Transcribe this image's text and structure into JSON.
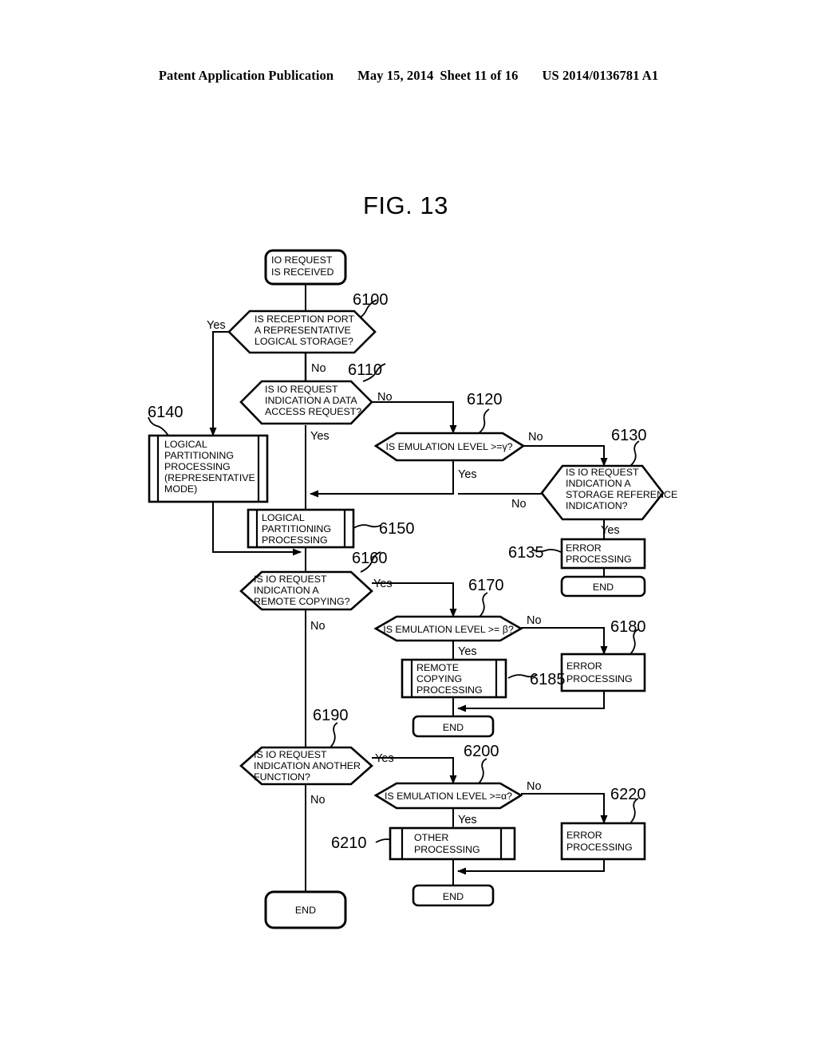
{
  "header": {
    "publication": "Patent Application Publication",
    "date": "May 15, 2014",
    "sheet": "Sheet 11 of 16",
    "patent_number": "US 2014/0136781 A1"
  },
  "figure": {
    "title": "FIG. 13"
  },
  "nodes": {
    "start": {
      "id": "start",
      "label_lines": [
        "IO REQUEST",
        "IS RECEIVED"
      ],
      "shape": "terminator"
    },
    "n6100": {
      "ref": "6100",
      "label_lines": [
        "IS RECEPTION PORT",
        "A REPRESENTATIVE",
        "LOGICAL STORAGE?"
      ],
      "shape": "decision"
    },
    "n6110": {
      "ref": "6110",
      "label_lines": [
        "IS IO REQUEST",
        "INDICATION A DATA",
        "ACCESS REQUEST?"
      ],
      "shape": "decision"
    },
    "n6120": {
      "ref": "6120",
      "label_lines": [
        "IS EMULATION LEVEL >=γ?"
      ],
      "shape": "decision"
    },
    "n6130": {
      "ref": "6130",
      "label_lines": [
        "IS IO REQUEST",
        "INDICATION A",
        "STORAGE REFERENCE",
        "INDICATION?"
      ],
      "shape": "decision"
    },
    "n6135": {
      "ref": "6135",
      "label_lines": [
        "ERROR",
        "PROCESSING"
      ],
      "shape": "process"
    },
    "n6140": {
      "ref": "6140",
      "label_lines": [
        "LOGICAL",
        "PARTITIONING",
        "PROCESSING",
        "(REPRESENTATIVE",
        "MODE)"
      ],
      "shape": "predefined"
    },
    "n6150": {
      "ref": "6150",
      "label_lines": [
        "LOGICAL",
        "PARTITIONING",
        "PROCESSING"
      ],
      "shape": "predefined"
    },
    "n6160": {
      "ref": "6160",
      "label_lines": [
        "IS IO REQUEST",
        "INDICATION A",
        "REMOTE COPYING?"
      ],
      "shape": "decision"
    },
    "n6170": {
      "ref": "6170",
      "label_lines": [
        "IS EMULATION LEVEL >= β?"
      ],
      "shape": "decision"
    },
    "n6180": {
      "ref": "6180",
      "label_lines": [
        "ERROR",
        "PROCESSING"
      ],
      "shape": "process"
    },
    "n6185": {
      "ref": "6185",
      "label_lines": [
        "REMOTE",
        "COPYING",
        "PROCESSING"
      ],
      "shape": "predefined"
    },
    "n6190": {
      "ref": "6190",
      "label_lines": [
        "IS IO REQUEST",
        "INDICATION ANOTHER",
        "FUNCTION?"
      ],
      "shape": "decision"
    },
    "n6200": {
      "ref": "6200",
      "label_lines": [
        "IS EMULATION LEVEL >=α?"
      ],
      "shape": "decision"
    },
    "n6210": {
      "ref": "6210",
      "label_lines": [
        "OTHER",
        "PROCESSING"
      ],
      "shape": "predefined"
    },
    "n6220": {
      "ref": "6220",
      "label_lines": [
        "ERROR",
        "PROCESSING"
      ],
      "shape": "process"
    },
    "end_6135": {
      "label_lines": [
        "END"
      ],
      "shape": "terminator"
    },
    "end_6185": {
      "label_lines": [
        "END"
      ],
      "shape": "terminator"
    },
    "end_6210": {
      "label_lines": [
        "END"
      ],
      "shape": "terminator"
    },
    "end_main": {
      "label_lines": [
        "END"
      ],
      "shape": "terminator"
    }
  },
  "edge_labels": {
    "e6100_yes": "Yes",
    "e6100_no": "No",
    "e6110_no": "No",
    "e6110_yes": "Yes",
    "e6120_no": "No",
    "e6120_yes": "Yes",
    "e6130_no": "No",
    "e6130_yes": "Yes",
    "e6160_yes": "Yes",
    "e6160_no": "No",
    "e6170_no": "No",
    "e6170_yes": "Yes",
    "e6190_yes": "Yes",
    "e6190_no": "No",
    "e6200_no": "No",
    "e6200_yes": "Yes"
  },
  "refs": {
    "r6100": "6100",
    "r6110": "6110",
    "r6120": "6120",
    "r6130": "6130",
    "r6135": "6135",
    "r6140": "6140",
    "r6150": "6150",
    "r6160": "6160",
    "r6170": "6170",
    "r6180": "6180",
    "r6185": "6185",
    "r6190": "6190",
    "r6200": "6200",
    "r6210": "6210",
    "r6220": "6220"
  },
  "colors": {
    "ink": "#000000",
    "paper": "#ffffff"
  }
}
